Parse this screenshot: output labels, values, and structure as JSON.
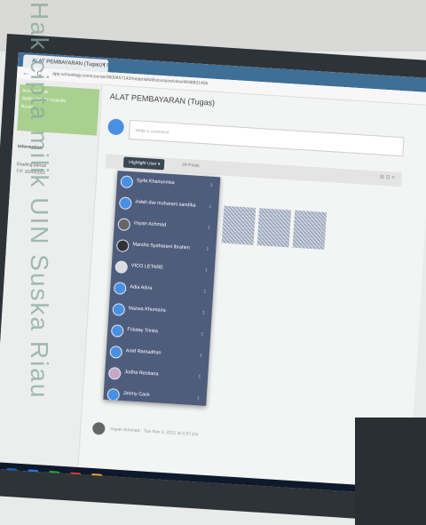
{
  "browser": {
    "tab_title": "ALAT PEMBAYARAN (Tugas) | Sc",
    "tab_close": "×",
    "back": "←",
    "reload": "C",
    "url": "app.schoology.com/course/3600457142/materials/discussion/view/4648831456"
  },
  "sidebar": {
    "access_code_label": "Access Code",
    "access_code_value": "JWEH-RQFD-TDW4M",
    "access_code_reset": "Reset",
    "information_label": "Information",
    "grading_period_label": "Grading period",
    "grading_period_value": "T.P. 2020/2021"
  },
  "main": {
    "title": "ALAT PEMBAYARAN (Tugas)",
    "comment_placeholder": "Write a comment",
    "highlight_user": "Highlight User ▾",
    "posts_count": "24 Posts",
    "toolbar_icons": "⊞ ⊟ ≡",
    "reply_meta": "Irsyan Achmad · Tue Nov 2, 2021 at 5:37 pm"
  },
  "dropdown_users": [
    {
      "name": "Syifa Khairunnisa",
      "count": "1"
    },
    {
      "name": "indah dwi muharani sandika",
      "count": "1"
    },
    {
      "name": "Irsyan Achmad",
      "count": "1"
    },
    {
      "name": "Marsha Syaharani Ibrahim",
      "count": "1"
    },
    {
      "name": "VICO LETARE",
      "count": "1"
    },
    {
      "name": "Adia Adira",
      "count": "1"
    },
    {
      "name": "Nazwa Khumaira",
      "count": "1"
    },
    {
      "name": "Frisday Trinita",
      "count": "1"
    },
    {
      "name": "Arief Ramadhan",
      "count": "1"
    },
    {
      "name": "Jodha Restiana",
      "count": "1"
    },
    {
      "name": "Jimmy Cack",
      "count": "1"
    }
  ],
  "watermark": "Hak cipta milik UIN Suska Riau",
  "colors": {
    "accent_blue": "#4a90e2",
    "access_green": "#a9d08e",
    "dropdown_bg": "#4f5d7d",
    "taskbar": "#0e1a2c"
  }
}
